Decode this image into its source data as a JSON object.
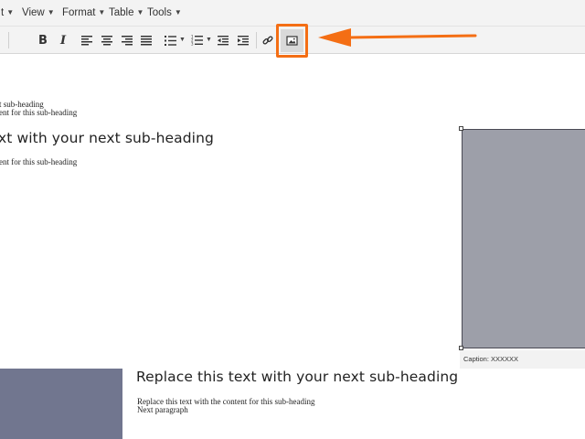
{
  "menubar": {
    "items": [
      {
        "label": "t"
      },
      {
        "label": "View"
      },
      {
        "label": "Format"
      },
      {
        "label": "Table"
      },
      {
        "label": "Tools"
      }
    ]
  },
  "toolbar": {
    "buttons": [
      {
        "name": "bold",
        "label": "B"
      },
      {
        "name": "italic",
        "label": "I"
      },
      {
        "name": "align-left"
      },
      {
        "name": "align-center"
      },
      {
        "name": "align-right"
      },
      {
        "name": "align-justify"
      },
      {
        "name": "bullet-list"
      },
      {
        "name": "numbered-list"
      },
      {
        "name": "outdent"
      },
      {
        "name": "indent"
      },
      {
        "name": "link"
      },
      {
        "name": "insert-image",
        "highlighted": true
      }
    ],
    "highlight_color": "#f46e14"
  },
  "document": {
    "top_line_1": "t sub-heading",
    "top_line_2": "ent for this sub-heading",
    "heading_1": "xt with your next sub-heading",
    "body_1": "ent for this sub-heading",
    "figure_caption": "Caption: XXXXXX",
    "heading_2": "Replace this text with your next sub-heading",
    "body_2_line_1": "Replace this text with the content for this sub-heading",
    "body_2_line_2": "Next paragraph"
  },
  "colors": {
    "figure_right": "#9d9fa9",
    "figure_bottom_left": "#71768f",
    "toolbar_bg": "#f3f3f3"
  }
}
